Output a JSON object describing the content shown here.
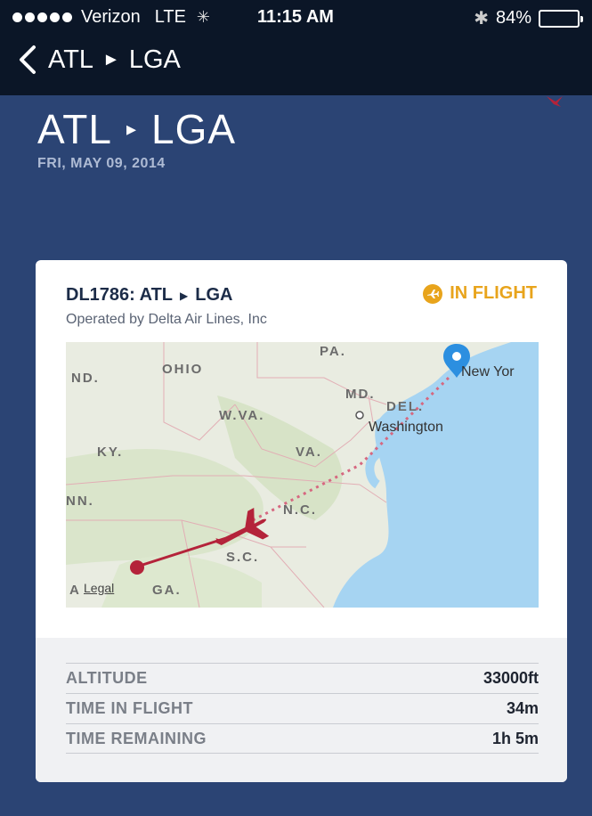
{
  "status_bar": {
    "carrier": "Verizon",
    "network": "LTE",
    "time": "11:15 AM",
    "battery": "84%",
    "battery_level": 0.84
  },
  "nav": {
    "title_from": "ATL",
    "title_to": "LGA"
  },
  "hero": {
    "from": "ATL",
    "to": "LGA",
    "date": "FRI, MAY 09, 2014"
  },
  "flight": {
    "code_route": "DL1786: ATL",
    "to": "LGA",
    "operator": "Operated by Delta Air Lines, Inc",
    "status": "IN FLIGHT",
    "status_color": "#e8a41c"
  },
  "map": {
    "labels": {
      "pa": "PA.",
      "ohio": "OHIO",
      "nd": "ND.",
      "md": "MD.",
      "del": "DEL.",
      "wva": "W.VA.",
      "washington": "Washington",
      "ky": "KY.",
      "va": "VA.",
      "nn": "NN.",
      "nc": "N.C.",
      "sc": "S.C.",
      "ga": "GA.",
      "a": "A",
      "newyork": "New Yor"
    },
    "legal": "Legal"
  },
  "stats": [
    {
      "label": "ALTITUDE",
      "value": "33000ft"
    },
    {
      "label": "TIME IN FLIGHT",
      "value": "34m"
    },
    {
      "label": "TIME REMAINING",
      "value": "1h 5m"
    }
  ]
}
